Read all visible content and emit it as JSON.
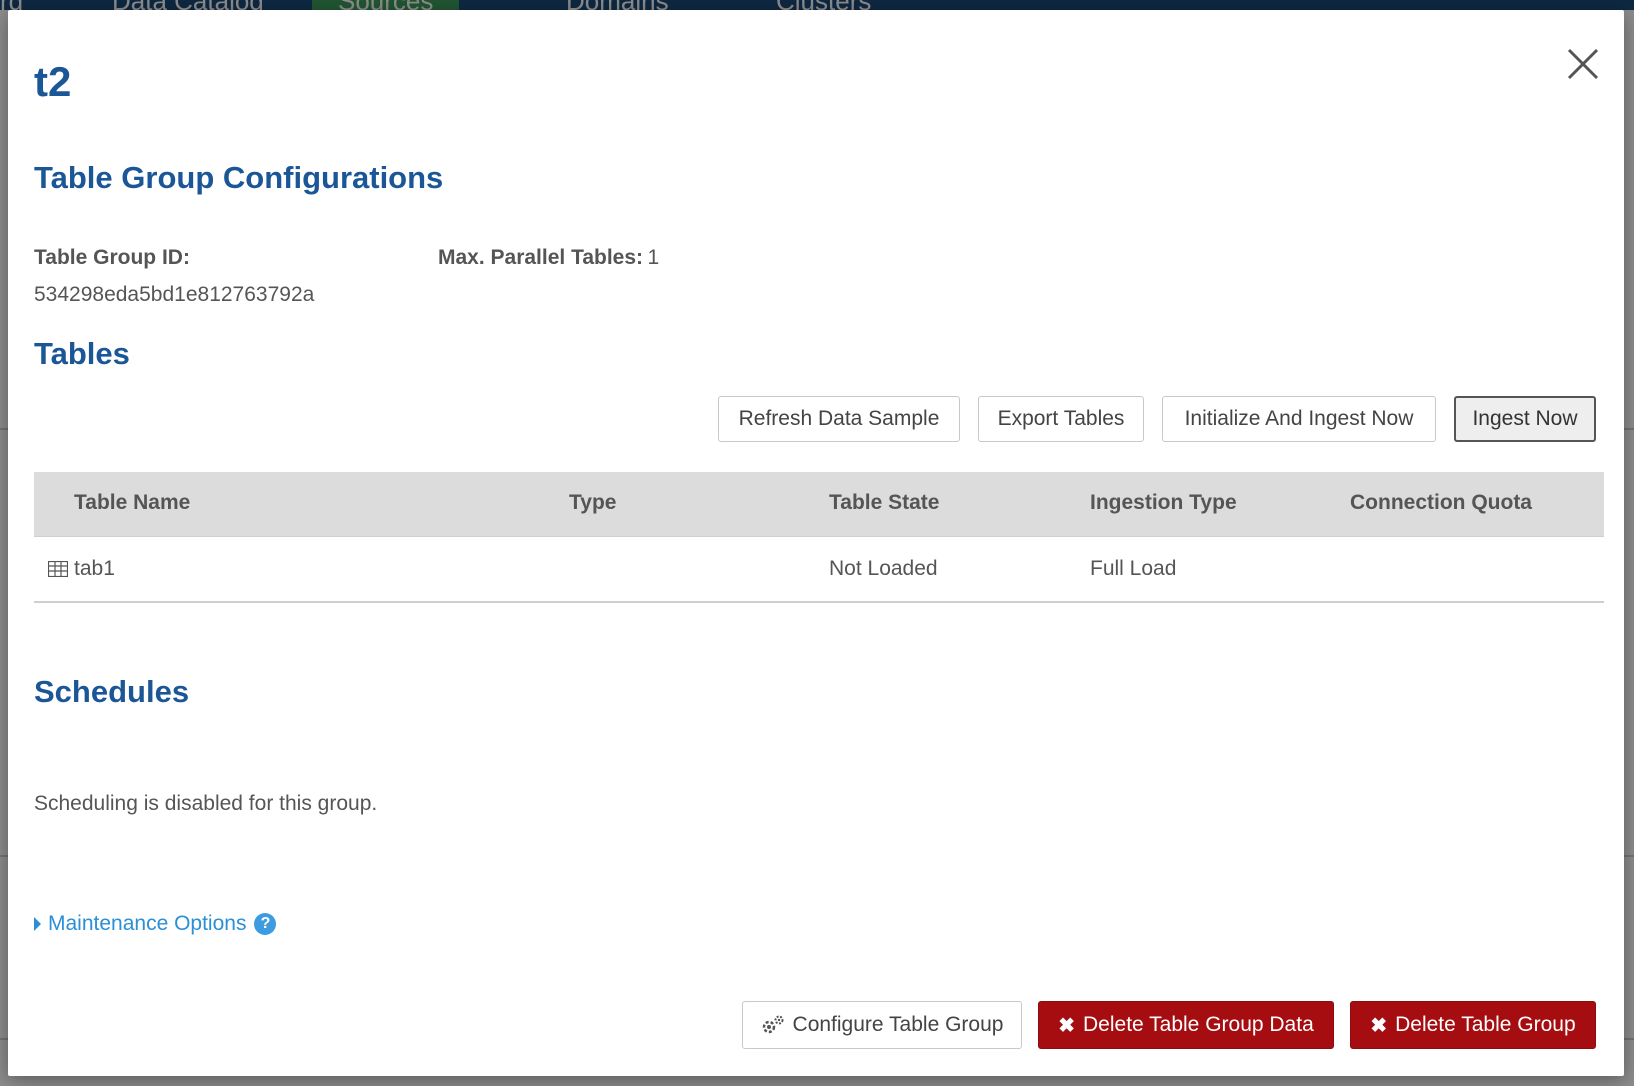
{
  "background": {
    "nav_items": [
      "rd",
      "Data Catalog",
      "Sources",
      "Domains",
      "Clusters"
    ]
  },
  "modal": {
    "title": "t2",
    "close_icon": "close-icon"
  },
  "configurations": {
    "heading": "Table Group Configurations",
    "table_group_id_label": "Table Group ID:",
    "table_group_id_value": "534298eda5bd1e812763792a",
    "max_parallel_label": "Max. Parallel Tables:",
    "max_parallel_value": "1"
  },
  "tables": {
    "heading": "Tables",
    "buttons": {
      "refresh": "Refresh Data Sample",
      "export": "Export Tables",
      "initialize_ingest": "Initialize And Ingest Now",
      "ingest": "Ingest Now"
    },
    "columns": [
      "Table Name",
      "Type",
      "Table State",
      "Ingestion Type",
      "Connection Quota"
    ],
    "rows": [
      {
        "icon": "table-icon",
        "name": "tab1",
        "type": "",
        "state": "Not Loaded",
        "ingestion_type": "Full Load",
        "connection_quota": ""
      }
    ]
  },
  "schedules": {
    "heading": "Schedules",
    "text": "Scheduling is disabled for this group."
  },
  "maintenance": {
    "label": "Maintenance Options",
    "help_icon": "help-icon"
  },
  "footer": {
    "configure": "Configure Table Group",
    "delete_data": "Delete Table Group Data",
    "delete_group": "Delete Table Group"
  },
  "colors": {
    "heading": "#1b5697",
    "danger": "#a50d10",
    "link": "#2a8fd6"
  }
}
